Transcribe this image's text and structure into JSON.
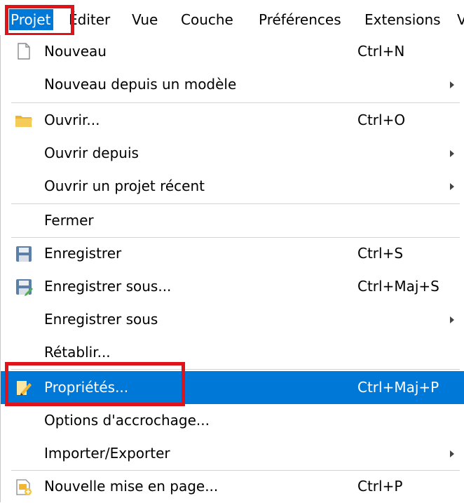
{
  "menubar": {
    "items": [
      {
        "label": "Projet",
        "active": true
      },
      {
        "label": "Éditer"
      },
      {
        "label": "Vue"
      },
      {
        "label": "Couche"
      },
      {
        "label": "Préférences"
      },
      {
        "label": "Extensions"
      },
      {
        "label": "V"
      }
    ]
  },
  "menu": {
    "items": [
      {
        "label": "Nouveau",
        "shortcut": "Ctrl+N",
        "icon": "new-document-icon"
      },
      {
        "label": "Nouveau depuis un modèle",
        "submenu": true
      },
      {
        "label": "Ouvrir...",
        "shortcut": "Ctrl+O",
        "icon": "folder-icon"
      },
      {
        "label": "Ouvrir depuis",
        "submenu": true
      },
      {
        "label": "Ouvrir un projet récent",
        "submenu": true
      },
      {
        "label": "Fermer"
      },
      {
        "label": "Enregistrer",
        "shortcut": "Ctrl+S",
        "icon": "save-icon"
      },
      {
        "label": "Enregistrer sous...",
        "shortcut": "Ctrl+Maj+S",
        "icon": "save-as-icon"
      },
      {
        "label": "Enregistrer sous",
        "submenu": true
      },
      {
        "label": "Rétablir..."
      },
      {
        "label": "Propriétés...",
        "shortcut": "Ctrl+Maj+P",
        "icon": "properties-icon",
        "selected": true
      },
      {
        "label": "Options d'accrochage..."
      },
      {
        "label": "Importer/Exporter",
        "submenu": true
      },
      {
        "label": "Nouvelle mise en page...",
        "shortcut": "Ctrl+P",
        "icon": "new-layout-icon"
      }
    ]
  },
  "colors": {
    "accent": "#0078d7",
    "highlight_box": "#e0131b"
  }
}
